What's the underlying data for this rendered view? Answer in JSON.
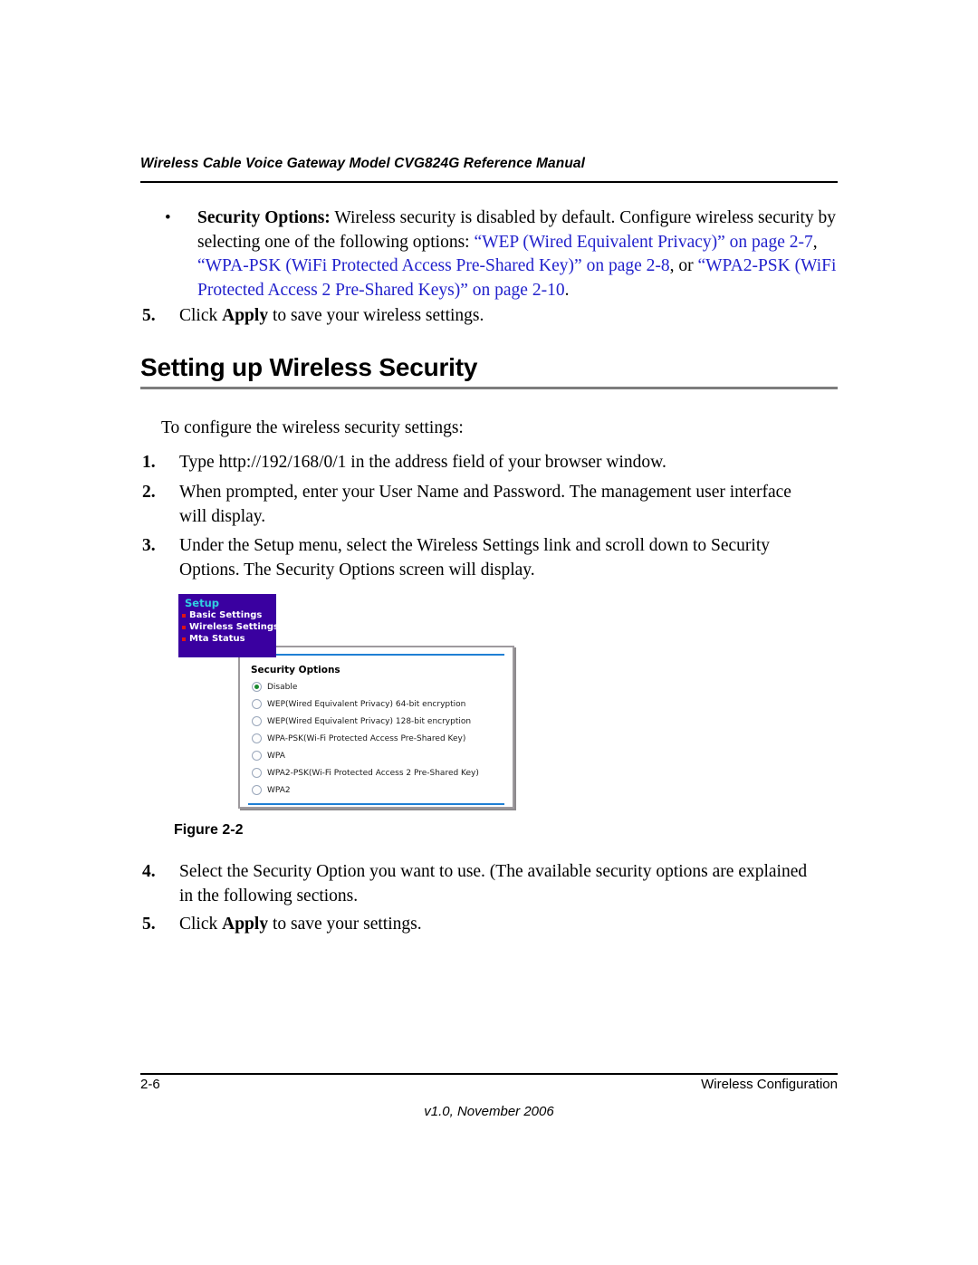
{
  "header": {
    "running_title": "Wireless Cable Voice Gateway Model CVG824G Reference Manual"
  },
  "bullet": {
    "marker": "•",
    "label": "Security Options:",
    "text_part1": " Wireless security is disabled by default. Configure wireless security by selecting one of the following options: ",
    "link1": "“WEP (Wired Equivalent Privacy)” on page 2-7",
    "sep1": ", ",
    "link2": "“WPA-PSK (WiFi Protected Access Pre-Shared Key)” on page 2-8",
    "sep2": ", or ",
    "link3": "“WPA2-PSK (WiFi Protected Access 2 Pre-Shared Keys)” on page 2-10",
    "sep3": "."
  },
  "top_step": {
    "num": "5.",
    "text_pre": "Click ",
    "bold": "Apply",
    "text_post": " to save your wireless settings."
  },
  "section": {
    "heading": "Setting up Wireless Security",
    "lead_in": "To configure the wireless security settings:"
  },
  "steps": [
    {
      "num": "1.",
      "text": "Type http://192/168/0/1 in the address field of your browser window."
    },
    {
      "num": "2.",
      "text": "When prompted, enter your User Name and Password. The management user interface will display."
    },
    {
      "num": "3.",
      "text": "Under the Setup menu, select the Wireless Settings link and scroll down to Security Options. The Security Options screen will display."
    }
  ],
  "figure": {
    "caption": "Figure 2-2",
    "nav": {
      "title": "Setup",
      "items": [
        {
          "label": "Basic Settings"
        },
        {
          "label": "Wireless Settings"
        },
        {
          "label": "Mta Status"
        }
      ]
    },
    "security_panel": {
      "title": "Security Options",
      "options": [
        {
          "label": "Disable",
          "selected": true
        },
        {
          "label": "WEP(Wired Equivalent Privacy) 64-bit encryption",
          "selected": false
        },
        {
          "label": "WEP(Wired Equivalent Privacy) 128-bit encryption",
          "selected": false
        },
        {
          "label": "WPA-PSK(Wi-Fi Protected Access Pre-Shared Key)",
          "selected": false
        },
        {
          "label": "WPA",
          "selected": false
        },
        {
          "label": "WPA2-PSK(Wi-Fi Protected Access 2 Pre-Shared Key)",
          "selected": false
        },
        {
          "label": "WPA2",
          "selected": false
        }
      ]
    },
    "colors": {
      "nav_background": "#3a00a0",
      "nav_title": "#31cfe0",
      "nav_bullet": "#e01414",
      "panel_rule": "#1f7fd4",
      "radio_selected": "#1a8a2e"
    }
  },
  "bottom_steps": [
    {
      "num": "4.",
      "text": "Select the Security Option you want to use. (The available security options are explained in the following sections."
    }
  ],
  "final_step": {
    "num": "5.",
    "text_pre": "Click ",
    "bold": "Apply",
    "text_post": " to save your settings."
  },
  "footer": {
    "page_number": "2-6",
    "chapter": "Wireless Configuration",
    "version": "v1.0, November 2006"
  },
  "link_color": "#2222cc"
}
